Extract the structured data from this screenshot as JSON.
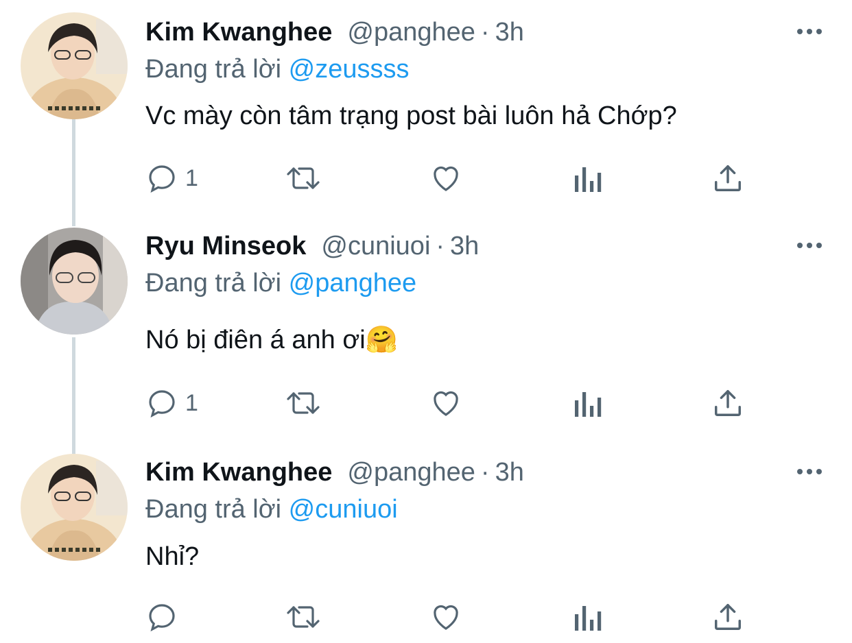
{
  "thread": {
    "tweets": [
      {
        "name": "Kim Kwanghee",
        "handle": "@panghee",
        "separator": "·",
        "time": "3h",
        "reply_prefix": "Đang trả lời",
        "reply_to": "@zeussss",
        "text": "Vc mày còn tâm trạng post bài luôn hả Chớp?",
        "reply_count": "1",
        "avatar": "avatar-kim-kwanghee"
      },
      {
        "name": "Ryu Minseok",
        "handle": "@cuniuoi",
        "separator": "·",
        "time": "3h",
        "reply_prefix": "Đang trả lời",
        "reply_to": "@panghee",
        "text": "Nó bị điên á anh ơi",
        "emoji": "🤗",
        "reply_count": "1",
        "avatar": "avatar-ryu-minseok"
      },
      {
        "name": "Kim Kwanghee",
        "handle": "@panghee",
        "separator": "·",
        "time": "3h",
        "reply_prefix": "Đang trả lời",
        "reply_to": "@cuniuoi",
        "text": "Nhỉ?",
        "reply_count": "",
        "avatar": "avatar-kim-kwanghee"
      }
    ],
    "icons": [
      "reply-icon",
      "retweet-icon",
      "like-icon",
      "views-icon",
      "share-icon",
      "more-icon"
    ],
    "colors": {
      "text": "#0f1419",
      "secondary": "#536471",
      "mention": "#1d9bf0",
      "thread_line": "#cfd9de"
    }
  }
}
